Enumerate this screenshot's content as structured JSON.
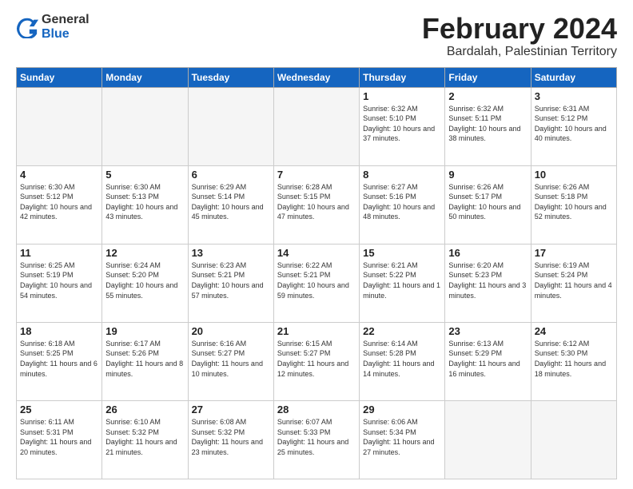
{
  "logo": {
    "general": "General",
    "blue": "Blue",
    "icon_title": "GeneralBlue logo"
  },
  "header": {
    "month_title": "February 2024",
    "subtitle": "Bardalah, Palestinian Territory"
  },
  "weekdays": [
    "Sunday",
    "Monday",
    "Tuesday",
    "Wednesday",
    "Thursday",
    "Friday",
    "Saturday"
  ],
  "days": [
    {
      "num": "",
      "sunrise": "",
      "sunset": "",
      "daylight": "",
      "empty": true
    },
    {
      "num": "",
      "sunrise": "",
      "sunset": "",
      "daylight": "",
      "empty": true
    },
    {
      "num": "",
      "sunrise": "",
      "sunset": "",
      "daylight": "",
      "empty": true
    },
    {
      "num": "",
      "sunrise": "",
      "sunset": "",
      "daylight": "",
      "empty": true
    },
    {
      "num": "1",
      "sunrise": "Sunrise: 6:32 AM",
      "sunset": "Sunset: 5:10 PM",
      "daylight": "Daylight: 10 hours and 37 minutes."
    },
    {
      "num": "2",
      "sunrise": "Sunrise: 6:32 AM",
      "sunset": "Sunset: 5:11 PM",
      "daylight": "Daylight: 10 hours and 38 minutes."
    },
    {
      "num": "3",
      "sunrise": "Sunrise: 6:31 AM",
      "sunset": "Sunset: 5:12 PM",
      "daylight": "Daylight: 10 hours and 40 minutes."
    },
    {
      "num": "4",
      "sunrise": "Sunrise: 6:30 AM",
      "sunset": "Sunset: 5:12 PM",
      "daylight": "Daylight: 10 hours and 42 minutes."
    },
    {
      "num": "5",
      "sunrise": "Sunrise: 6:30 AM",
      "sunset": "Sunset: 5:13 PM",
      "daylight": "Daylight: 10 hours and 43 minutes."
    },
    {
      "num": "6",
      "sunrise": "Sunrise: 6:29 AM",
      "sunset": "Sunset: 5:14 PM",
      "daylight": "Daylight: 10 hours and 45 minutes."
    },
    {
      "num": "7",
      "sunrise": "Sunrise: 6:28 AM",
      "sunset": "Sunset: 5:15 PM",
      "daylight": "Daylight: 10 hours and 47 minutes."
    },
    {
      "num": "8",
      "sunrise": "Sunrise: 6:27 AM",
      "sunset": "Sunset: 5:16 PM",
      "daylight": "Daylight: 10 hours and 48 minutes."
    },
    {
      "num": "9",
      "sunrise": "Sunrise: 6:26 AM",
      "sunset": "Sunset: 5:17 PM",
      "daylight": "Daylight: 10 hours and 50 minutes."
    },
    {
      "num": "10",
      "sunrise": "Sunrise: 6:26 AM",
      "sunset": "Sunset: 5:18 PM",
      "daylight": "Daylight: 10 hours and 52 minutes."
    },
    {
      "num": "11",
      "sunrise": "Sunrise: 6:25 AM",
      "sunset": "Sunset: 5:19 PM",
      "daylight": "Daylight: 10 hours and 54 minutes."
    },
    {
      "num": "12",
      "sunrise": "Sunrise: 6:24 AM",
      "sunset": "Sunset: 5:20 PM",
      "daylight": "Daylight: 10 hours and 55 minutes."
    },
    {
      "num": "13",
      "sunrise": "Sunrise: 6:23 AM",
      "sunset": "Sunset: 5:21 PM",
      "daylight": "Daylight: 10 hours and 57 minutes."
    },
    {
      "num": "14",
      "sunrise": "Sunrise: 6:22 AM",
      "sunset": "Sunset: 5:21 PM",
      "daylight": "Daylight: 10 hours and 59 minutes."
    },
    {
      "num": "15",
      "sunrise": "Sunrise: 6:21 AM",
      "sunset": "Sunset: 5:22 PM",
      "daylight": "Daylight: 11 hours and 1 minute."
    },
    {
      "num": "16",
      "sunrise": "Sunrise: 6:20 AM",
      "sunset": "Sunset: 5:23 PM",
      "daylight": "Daylight: 11 hours and 3 minutes."
    },
    {
      "num": "17",
      "sunrise": "Sunrise: 6:19 AM",
      "sunset": "Sunset: 5:24 PM",
      "daylight": "Daylight: 11 hours and 4 minutes."
    },
    {
      "num": "18",
      "sunrise": "Sunrise: 6:18 AM",
      "sunset": "Sunset: 5:25 PM",
      "daylight": "Daylight: 11 hours and 6 minutes."
    },
    {
      "num": "19",
      "sunrise": "Sunrise: 6:17 AM",
      "sunset": "Sunset: 5:26 PM",
      "daylight": "Daylight: 11 hours and 8 minutes."
    },
    {
      "num": "20",
      "sunrise": "Sunrise: 6:16 AM",
      "sunset": "Sunset: 5:27 PM",
      "daylight": "Daylight: 11 hours and 10 minutes."
    },
    {
      "num": "21",
      "sunrise": "Sunrise: 6:15 AM",
      "sunset": "Sunset: 5:27 PM",
      "daylight": "Daylight: 11 hours and 12 minutes."
    },
    {
      "num": "22",
      "sunrise": "Sunrise: 6:14 AM",
      "sunset": "Sunset: 5:28 PM",
      "daylight": "Daylight: 11 hours and 14 minutes."
    },
    {
      "num": "23",
      "sunrise": "Sunrise: 6:13 AM",
      "sunset": "Sunset: 5:29 PM",
      "daylight": "Daylight: 11 hours and 16 minutes."
    },
    {
      "num": "24",
      "sunrise": "Sunrise: 6:12 AM",
      "sunset": "Sunset: 5:30 PM",
      "daylight": "Daylight: 11 hours and 18 minutes."
    },
    {
      "num": "25",
      "sunrise": "Sunrise: 6:11 AM",
      "sunset": "Sunset: 5:31 PM",
      "daylight": "Daylight: 11 hours and 20 minutes."
    },
    {
      "num": "26",
      "sunrise": "Sunrise: 6:10 AM",
      "sunset": "Sunset: 5:32 PM",
      "daylight": "Daylight: 11 hours and 21 minutes."
    },
    {
      "num": "27",
      "sunrise": "Sunrise: 6:08 AM",
      "sunset": "Sunset: 5:32 PM",
      "daylight": "Daylight: 11 hours and 23 minutes."
    },
    {
      "num": "28",
      "sunrise": "Sunrise: 6:07 AM",
      "sunset": "Sunset: 5:33 PM",
      "daylight": "Daylight: 11 hours and 25 minutes."
    },
    {
      "num": "29",
      "sunrise": "Sunrise: 6:06 AM",
      "sunset": "Sunset: 5:34 PM",
      "daylight": "Daylight: 11 hours and 27 minutes."
    },
    {
      "num": "",
      "sunrise": "",
      "sunset": "",
      "daylight": "",
      "empty": true
    },
    {
      "num": "",
      "sunrise": "",
      "sunset": "",
      "daylight": "",
      "empty": true
    }
  ]
}
